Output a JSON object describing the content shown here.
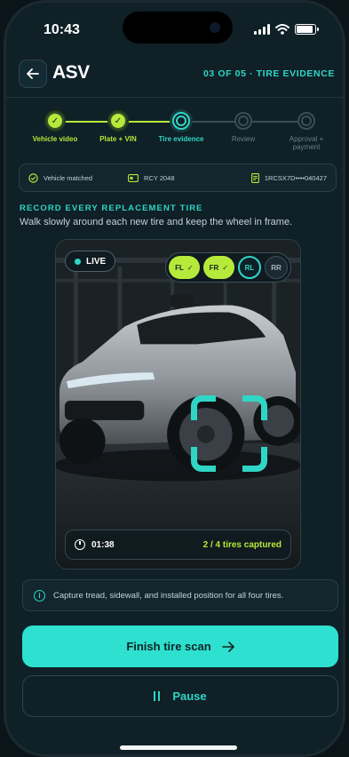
{
  "status_bar": {
    "time": "10:43"
  },
  "header": {
    "title": "ASV",
    "step_label": "03 OF 05 · TIRE EVIDENCE"
  },
  "stepper": {
    "steps": [
      {
        "label": "Vehicle video",
        "state": "done"
      },
      {
        "label": "Plate + VIN",
        "state": "done"
      },
      {
        "label": "Tire evidence",
        "state": "current"
      },
      {
        "label": "Review",
        "state": "todo"
      },
      {
        "label": "Approval + payment",
        "state": "todo"
      }
    ]
  },
  "info_strip": {
    "vehicle_status": "Vehicle matched",
    "plate": "RCY 2048",
    "vin": "1RCSX7D••••040427"
  },
  "section": {
    "title": "RECORD EVERY REPLACEMENT TIRE",
    "subtitle": "Walk slowly around each new tire and keep the wheel in frame."
  },
  "camera": {
    "live_label": "LIVE",
    "tires": [
      {
        "label": "FL",
        "state": "captured"
      },
      {
        "label": "FR",
        "state": "captured"
      },
      {
        "label": "RL",
        "state": "active"
      },
      {
        "label": "RR",
        "state": "pending"
      }
    ],
    "timer": "01:38",
    "captured_count": "2 / 4 tires captured"
  },
  "hint": {
    "text": "Capture tread, sidewall, and installed position for all four tires."
  },
  "actions": {
    "primary_label": "Finish tire scan",
    "secondary_label": "Pause"
  },
  "colors": {
    "accent": "#2fd6c5",
    "success": "#b6ea3a",
    "background": "#0f2027"
  }
}
